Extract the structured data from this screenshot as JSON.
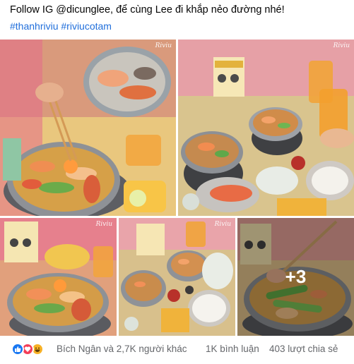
{
  "post": {
    "caption": "Follow IG @dicunglee, để cùng Lee đi khắp nẻo đường nhé!",
    "hashtags": [
      "#thanhriviu",
      "#riviucotam"
    ]
  },
  "photos": {
    "watermark": "Riviu",
    "more_count": "+3",
    "items": [
      {
        "name": "hotpot-closeup-chopsticks"
      },
      {
        "name": "hotpot-table-overview"
      },
      {
        "name": "hotpot-with-noodles"
      },
      {
        "name": "hotpot-flatlay"
      },
      {
        "name": "hotpot-ladle-vegetables"
      }
    ]
  },
  "footer": {
    "reaction_icons": [
      "like-icon",
      "love-icon",
      "haha-icon"
    ],
    "reaction_names": "Bích Ngân và 2,7K người khác",
    "comments": "1K bình luận",
    "shares": "403 lượt chia sẻ"
  },
  "colors": {
    "link": "#216fdb",
    "secondary_text": "#65676b",
    "like": "#1877f2",
    "love": "#f33e58",
    "haha": "#f7b125"
  }
}
